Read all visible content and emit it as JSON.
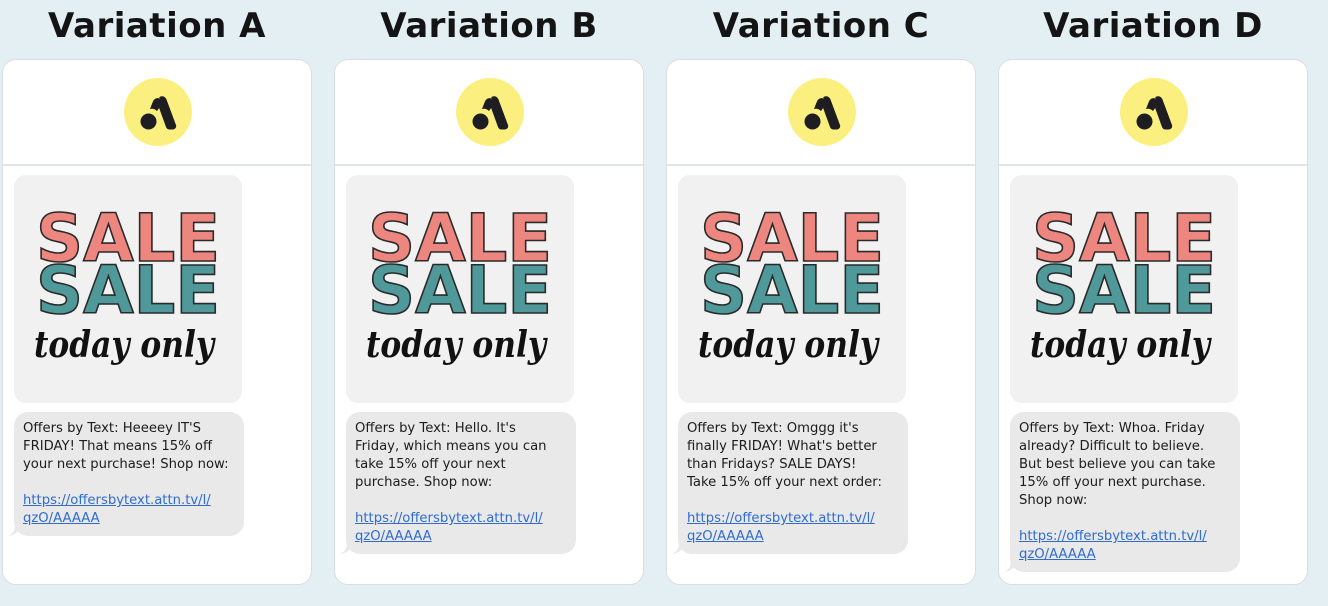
{
  "colors": {
    "background": "#e3eff3",
    "avatar": "#fbf07f",
    "sale_top": "#ee8680",
    "sale_bottom": "#4f999b",
    "bubble": "#e9e9ea",
    "link": "#2f6ccf"
  },
  "icons": {
    "avatar": "attentive-logo-icon"
  },
  "variations": [
    {
      "title": "Variation A",
      "image": {
        "sale_1": "SALE",
        "sale_2": "SALE",
        "script": "today only"
      },
      "message_lines": [
        "Offers by Text: Heeeey IT'S",
        "FRIDAY! That means 15% off",
        "your next purchase! Shop now:"
      ],
      "link_lines": [
        "https://offersbytext.attn.tv/l/",
        "qzO/AAAAA"
      ]
    },
    {
      "title": "Variation B",
      "image": {
        "sale_1": "SALE",
        "sale_2": "SALE",
        "script": "today only"
      },
      "message_lines": [
        "Offers by Text: Hello. It's",
        "Friday, which means you can",
        "take 15% off your next",
        "purchase. Shop now:"
      ],
      "link_lines": [
        "https://offersbytext.attn.tv/l/",
        "qzO/AAAAA"
      ]
    },
    {
      "title": "Variation C",
      "image": {
        "sale_1": "SALE",
        "sale_2": "SALE",
        "script": "today only"
      },
      "message_lines": [
        "Offers by Text: Omggg it's",
        "finally FRIDAY! What's better",
        "than Fridays? SALE DAYS!",
        "Take 15% off your next order:"
      ],
      "link_lines": [
        "https://offersbytext.attn.tv/l/",
        "qzO/AAAAA"
      ]
    },
    {
      "title": "Variation D",
      "image": {
        "sale_1": "SALE",
        "sale_2": "SALE",
        "script": "today only"
      },
      "message_lines": [
        "Offers by Text: Whoa. Friday",
        "already? Difficult to believe.",
        "But best believe you can take",
        "15% off your next purchase.",
        "Shop now:"
      ],
      "link_lines": [
        "https://offersbytext.attn.tv/l/",
        "qzO/AAAAA"
      ]
    }
  ]
}
